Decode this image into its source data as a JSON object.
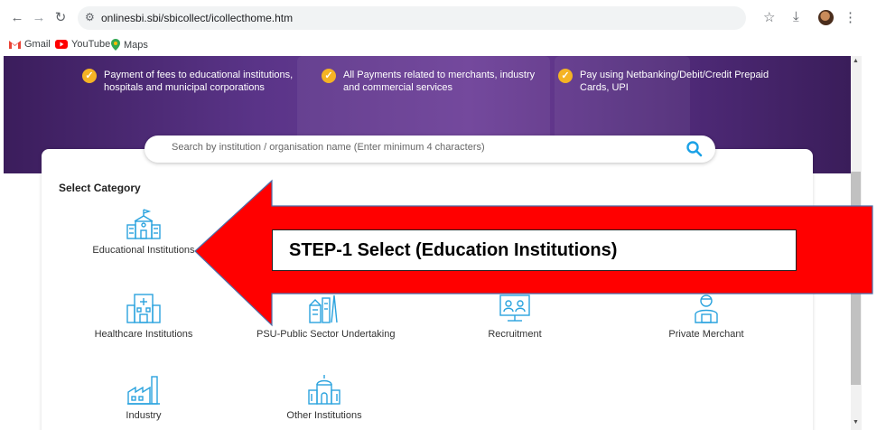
{
  "browser": {
    "url": "onlinesbi.sbi/sbicollect/icollecthome.htm",
    "bookmarks": [
      {
        "label": "Gmail",
        "icon": "gmail-icon"
      },
      {
        "label": "YouTube",
        "icon": "youtube-icon"
      },
      {
        "label": "Maps",
        "icon": "maps-icon"
      }
    ]
  },
  "hero": {
    "features": [
      {
        "text": "Payment of fees to educational institutions, hospitals and municipal corporations"
      },
      {
        "text": "All Payments related to merchants, industry and commercial services"
      },
      {
        "text": "Pay using Netbanking/Debit/Credit Prepaid Cards, UPI"
      }
    ]
  },
  "search": {
    "placeholder": "Search by institution / organisation name (Enter minimum 4 characters)"
  },
  "categories": {
    "heading": "Select Category",
    "items": [
      {
        "label": "Educational Institutions",
        "icon": "school-building-icon"
      },
      {
        "label": "Healthcare Institutions",
        "icon": "hospital-icon"
      },
      {
        "label": "PSU-Public Sector Undertaking",
        "icon": "psu-building-icon"
      },
      {
        "label": "Recruitment",
        "icon": "recruitment-icon"
      },
      {
        "label": "Private Merchant",
        "icon": "merchant-icon"
      },
      {
        "label": "Industry",
        "icon": "factory-icon"
      },
      {
        "label": "Other Institutions",
        "icon": "temple-icon"
      }
    ]
  },
  "annotation": {
    "step_text": "STEP-1 Select (Education Institutions)",
    "arrow_color": "#ff0000"
  },
  "colors": {
    "accent": "#1aa1e6",
    "check": "#f5b324",
    "hero": "#5a3488"
  }
}
